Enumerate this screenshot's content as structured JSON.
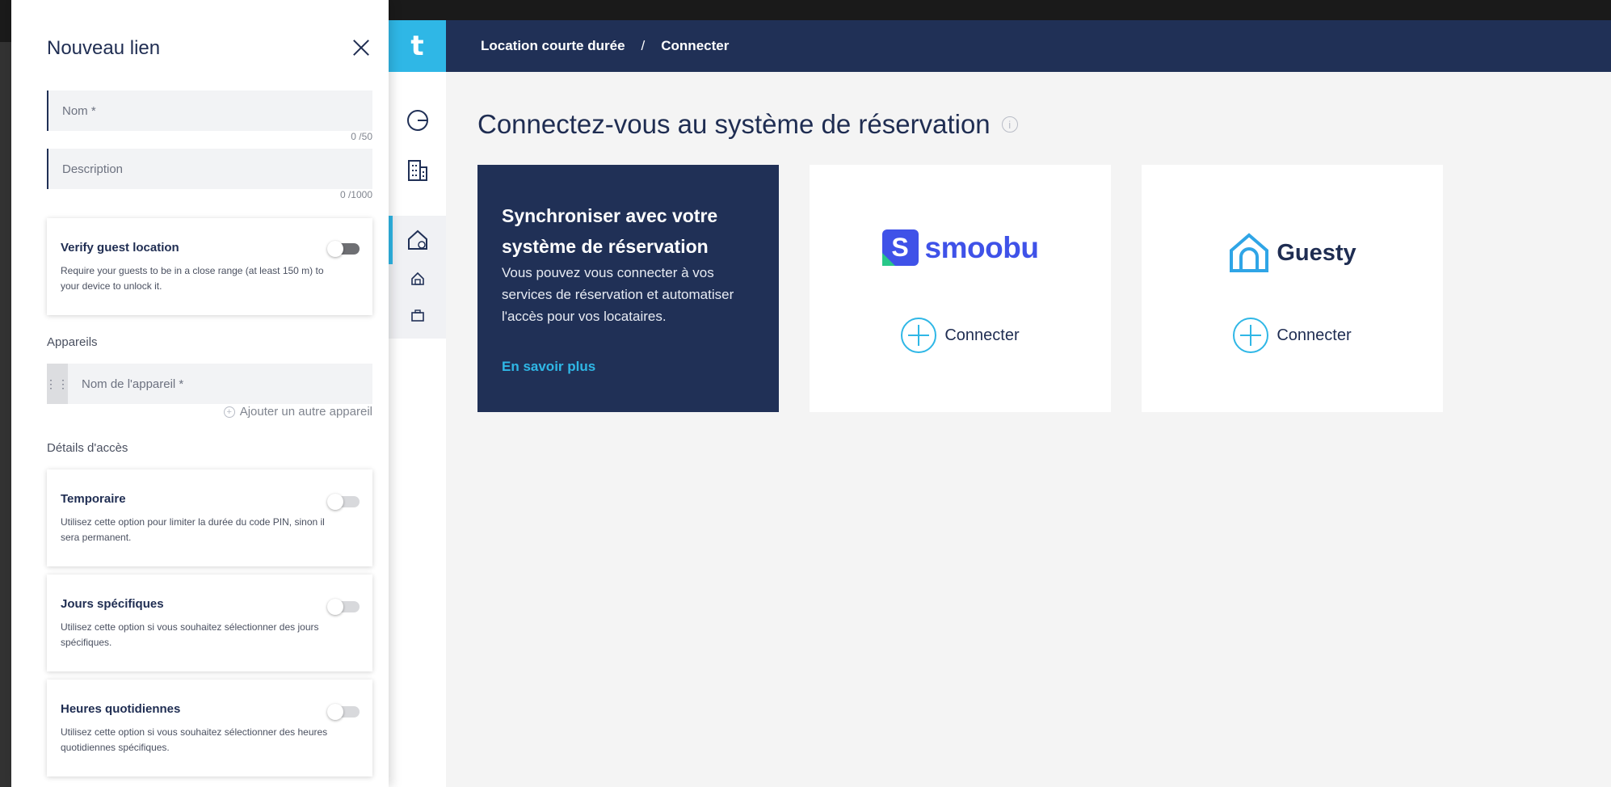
{
  "app": {
    "logo_letter": "t",
    "breadcrumb": [
      "Location courte durée",
      "/",
      "Connecter"
    ],
    "page_title": "Connectez-vous au système de réservation",
    "info_icon": "i",
    "sync_card": {
      "title": "Synchroniser avec votre système de réservation",
      "description": "Vous pouvez vous connecter à vos services de réservation et automatiser l'accès pour vos locataires.",
      "link": "En savoir plus"
    },
    "providers": [
      {
        "name": "smoobu",
        "mark": "S",
        "connect_label": "Connecter",
        "brand_color": "#3f52e8"
      },
      {
        "name": "Guesty",
        "connect_label": "Connecter",
        "brand_color": "#2fa5e6"
      }
    ],
    "colors": {
      "navy": "#203056",
      "accent": "#2fb7e6"
    }
  },
  "drawer": {
    "title": "Nouveau lien",
    "name_field": {
      "placeholder": "Nom *",
      "counter": "0 /50"
    },
    "description_field": {
      "placeholder": "Description",
      "counter": "0 /1000"
    },
    "verify_location": {
      "title": "Verify guest location",
      "description": "Require your guests to be in a close range (at least 150 m) to your device to unlock it.",
      "enabled": false
    },
    "devices_label": "Appareils",
    "device_field": {
      "placeholder": "Nom de l'appareil *"
    },
    "add_device": "Ajouter un autre appareil",
    "access_label": "Détails d'accès",
    "options": [
      {
        "title": "Temporaire",
        "description": "Utilisez cette option pour limiter la durée du code PIN, sinon il sera permanent.",
        "enabled": false
      },
      {
        "title": "Jours spécifiques",
        "description": "Utilisez cette option si vous souhaitez sélectionner des jours spécifiques.",
        "enabled": false
      },
      {
        "title": "Heures quotidiennes",
        "description": "Utilisez cette option si vous souhaitez sélectionner des heures quotidiennes spécifiques.",
        "enabled": false
      }
    ]
  }
}
